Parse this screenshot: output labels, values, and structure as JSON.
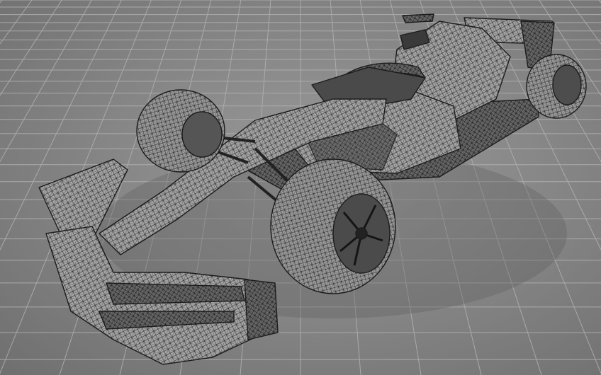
{
  "scene": {
    "subject": "race-car-mesh",
    "render_style": "wireframe",
    "colors": {
      "background": "#878787",
      "grid_line": "#b4b4b4",
      "mesh_fill": "#9c9c9c",
      "mesh_dark": "#2e2e2e",
      "mesh_line": "#1e1e1e",
      "tyre_fill": "#8e8e8e"
    }
  }
}
